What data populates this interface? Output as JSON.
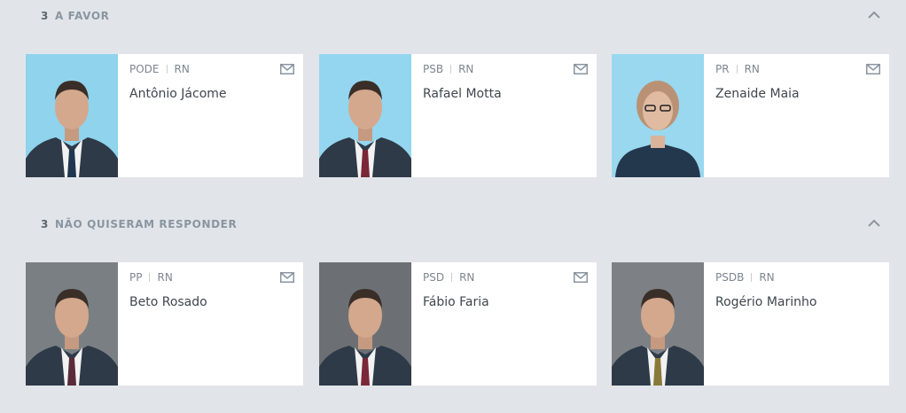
{
  "sections": [
    {
      "count": "3",
      "title": "A FAVOR",
      "toggle_icon": "chevron-up-icon",
      "cards": [
        {
          "party": "PODE",
          "state": "RN",
          "name": "Antônio Jácome",
          "photo_bg": "#8fd3ec",
          "tie": "#1f3550"
        },
        {
          "party": "PSB",
          "state": "RN",
          "name": "Rafael Motta",
          "photo_bg": "#94d6ef",
          "tie": "#7a2738"
        },
        {
          "party": "PR",
          "state": "RN",
          "name": "Zenaide Maia",
          "photo_bg": "#99d8ef",
          "tie": "#1f3550"
        }
      ]
    },
    {
      "count": "3",
      "title": "NÃO QUISERAM RESPONDER",
      "toggle_icon": "chevron-up-icon",
      "cards": [
        {
          "party": "PP",
          "state": "RN",
          "name": "Beto Rosado",
          "photo_bg": "#7a7f84",
          "tie": "#5a2a3a"
        },
        {
          "party": "PSD",
          "state": "RN",
          "name": "Fábio Faria",
          "photo_bg": "#6c7074",
          "tie": "#7a2738"
        },
        {
          "party": "PSDB",
          "state": "RN",
          "name": "Rogério Marinho",
          "photo_bg": "#7d8186",
          "tie": "#8a7a3a"
        }
      ]
    }
  ],
  "colors": {
    "page_bg": "#e1e5e9",
    "card_bg": "#ffffff",
    "icon": "#8a95a0"
  },
  "icons": {
    "mail": "mail-icon"
  }
}
